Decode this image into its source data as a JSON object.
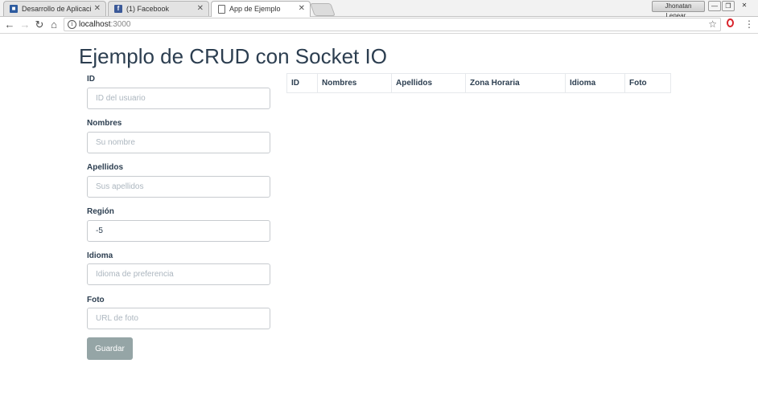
{
  "browser": {
    "tabs": [
      {
        "label": "Desarrollo de Aplicaciones",
        "favicon": "profile-icon",
        "color": "#2d5b9f",
        "active": false
      },
      {
        "label": "(1) Facebook",
        "favicon": "facebook-icon",
        "color": "#3b5998",
        "active": false
      },
      {
        "label": "App de Ejemplo",
        "favicon": "page-icon",
        "active": true
      }
    ],
    "user_name": "Jhonatan Lenear...",
    "url": {
      "host": "localhost",
      "port": ":3000"
    }
  },
  "page": {
    "title": "Ejemplo de CRUD con Socket IO"
  },
  "form": {
    "fields": [
      {
        "label": "ID",
        "placeholder": "ID del usuario",
        "value": ""
      },
      {
        "label": "Nombres",
        "placeholder": "Su nombre",
        "value": ""
      },
      {
        "label": "Apellidos",
        "placeholder": "Sus apellidos",
        "value": ""
      },
      {
        "label": "Región",
        "placeholder": "",
        "value": "-5"
      },
      {
        "label": "Idioma",
        "placeholder": "Idioma de preferencia",
        "value": ""
      },
      {
        "label": "Foto",
        "placeholder": "URL de foto",
        "value": ""
      }
    ],
    "submit_label": "Guardar"
  },
  "table": {
    "columns": [
      "ID",
      "Nombres",
      "Apellidos",
      "Zona Horaria",
      "Idioma",
      "Foto"
    ]
  },
  "colors": {
    "text": "#2c3e50",
    "button": "#95a5a6",
    "input_border": "#c7cbcf"
  }
}
